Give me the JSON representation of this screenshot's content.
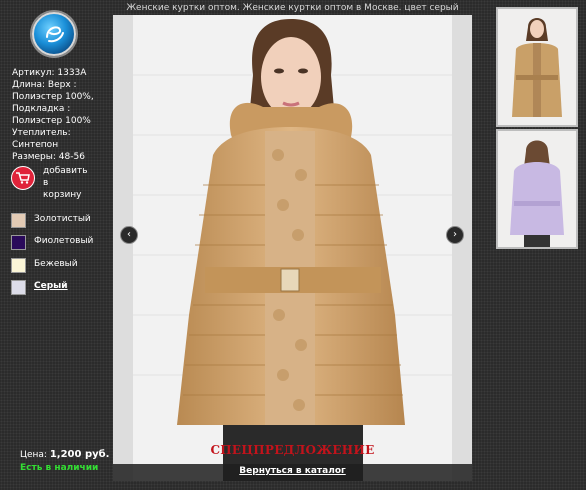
{
  "page_title": "Женские куртки оптом. Женские куртки оптом в Москве. цвет серый",
  "product": {
    "specs": [
      "Артикул: 1333А",
      "Длина: Верх :",
      "Полиэстер 100%,",
      "Подкладка :",
      "Полиэстер 100%",
      "Утеплитель:",
      "Синтепон",
      "Размеры: 48-56"
    ],
    "add_to_cart_lines": [
      "добавить",
      "в",
      "корзину"
    ],
    "price_label": "Цена:",
    "price_value": "1,200 руб.",
    "stock_status": "Есть в наличии"
  },
  "colors": [
    {
      "name": "Золотистый",
      "hex": "#e3cbb5",
      "active": false
    },
    {
      "name": "Фиолетовый",
      "hex": "#2a0a5a",
      "active": false
    },
    {
      "name": "Бежевый",
      "hex": "#fbf5d7",
      "active": false
    },
    {
      "name": "Серый",
      "hex": "#dcdce8",
      "active": true
    }
  ],
  "gallery": {
    "promo_text": "СПЕЦПРЕДЛОЖЕНИЕ",
    "back_link": "Вернуться в каталог",
    "prev_icon": "chevron-left-icon",
    "next_icon": "chevron-right-icon"
  },
  "thumbnails": [
    {
      "jacket_color": "#c9a068"
    },
    {
      "jacket_color": "#c8b9e3"
    }
  ],
  "accent_colors": {
    "cart": "#e0233a",
    "stock": "#33dd33",
    "promo": "#c3131b"
  }
}
